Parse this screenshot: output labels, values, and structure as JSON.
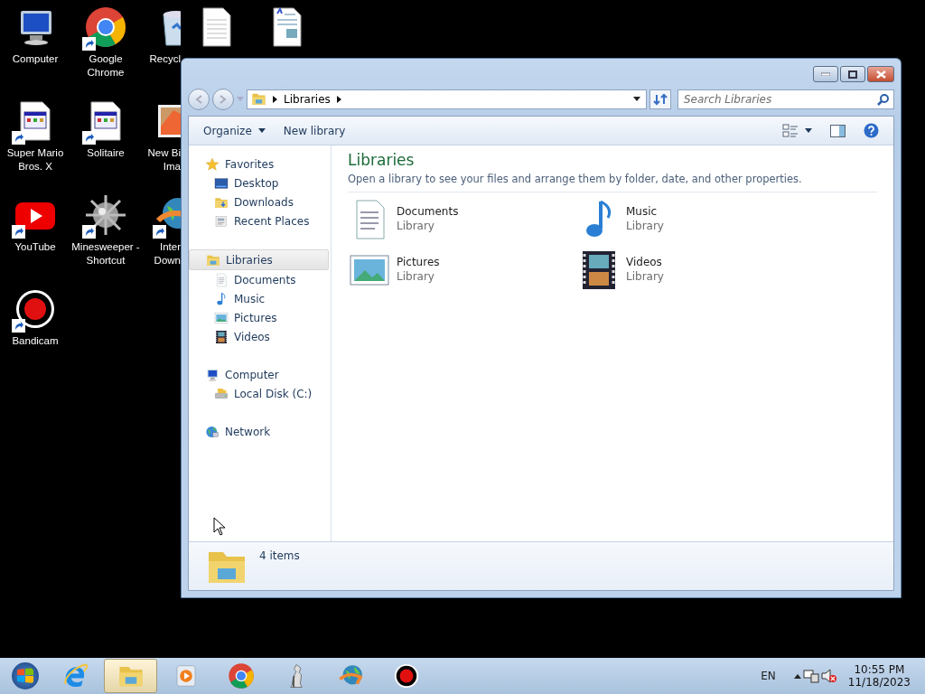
{
  "desktop": {
    "columns": [
      [
        {
          "label": "Computer",
          "kind": "computer",
          "shortcut": false
        },
        {
          "label": "Super Mario Bros. X",
          "kind": "app-window",
          "shortcut": true
        },
        {
          "label": "YouTube",
          "kind": "youtube",
          "shortcut": true
        },
        {
          "label": "Bandicam",
          "kind": "record",
          "shortcut": true
        }
      ],
      [
        {
          "label": "Google Chrome",
          "kind": "chrome",
          "shortcut": true
        },
        {
          "label": "Solitaire",
          "kind": "app-window",
          "shortcut": true
        },
        {
          "label": "Minesweeper - Shortcut",
          "kind": "mine",
          "shortcut": true
        }
      ],
      [
        {
          "label": "Recycl",
          "kind": "bin",
          "shortcut": false
        },
        {
          "label": "New Bi Ima",
          "kind": "image",
          "shortcut": false
        },
        {
          "label": "Inter Down",
          "kind": "globe",
          "shortcut": true
        }
      ],
      [
        {
          "kind": "textdoc",
          "shortcut": false
        }
      ],
      [
        {
          "kind": "richdoc",
          "shortcut": false
        }
      ]
    ]
  },
  "window": {
    "address": {
      "crumbs": [
        "Libraries"
      ]
    },
    "search": {
      "placeholder": "Search Libraries"
    },
    "toolbar": [
      {
        "label": "Organize",
        "menu": true
      },
      {
        "label": "New library",
        "menu": false
      }
    ],
    "nav": [
      {
        "label": "Favorites",
        "kind": "star",
        "selected": false,
        "children": [
          {
            "label": "Desktop",
            "kind": "desktop",
            "selected": false
          },
          {
            "label": "Downloads",
            "kind": "folder",
            "selected": false
          },
          {
            "label": "Recent Places",
            "kind": "recent",
            "selected": false
          }
        ]
      },
      {
        "label": "Libraries",
        "kind": "library",
        "selected": true,
        "children": [
          {
            "label": "Documents",
            "kind": "document",
            "selected": false
          },
          {
            "label": "Music",
            "kind": "note",
            "selected": false
          },
          {
            "label": "Pictures",
            "kind": "photo",
            "selected": false
          },
          {
            "label": "Videos",
            "kind": "film",
            "selected": false
          }
        ]
      },
      {
        "label": "Computer",
        "kind": "computer",
        "selected": false,
        "children": [
          {
            "label": "Local Disk (C:)",
            "kind": "disk",
            "selected": false
          }
        ]
      },
      {
        "label": "Network",
        "kind": "network",
        "selected": false
      }
    ],
    "heading": "Libraries",
    "description": "Open a library to see your files and arrange them by folder, date, and other properties.",
    "items": [
      {
        "name": "Documents",
        "type": "Library",
        "kind": "document"
      },
      {
        "name": "Music",
        "type": "Library",
        "kind": "note"
      },
      {
        "name": "Pictures",
        "type": "Library",
        "kind": "photo"
      },
      {
        "name": "Videos",
        "type": "Library",
        "kind": "film"
      }
    ],
    "status": "4 items"
  },
  "taskbar": {
    "apps": [
      {
        "kind": "ie",
        "active": false
      },
      {
        "kind": "library",
        "active": true
      },
      {
        "kind": "player",
        "active": false
      },
      {
        "kind": "chrome",
        "active": false
      },
      {
        "kind": "chess",
        "active": false
      },
      {
        "kind": "globe",
        "active": false
      },
      {
        "kind": "record",
        "active": false
      }
    ],
    "language": "EN",
    "time": "10:55 PM",
    "date": "11/18/2023"
  }
}
